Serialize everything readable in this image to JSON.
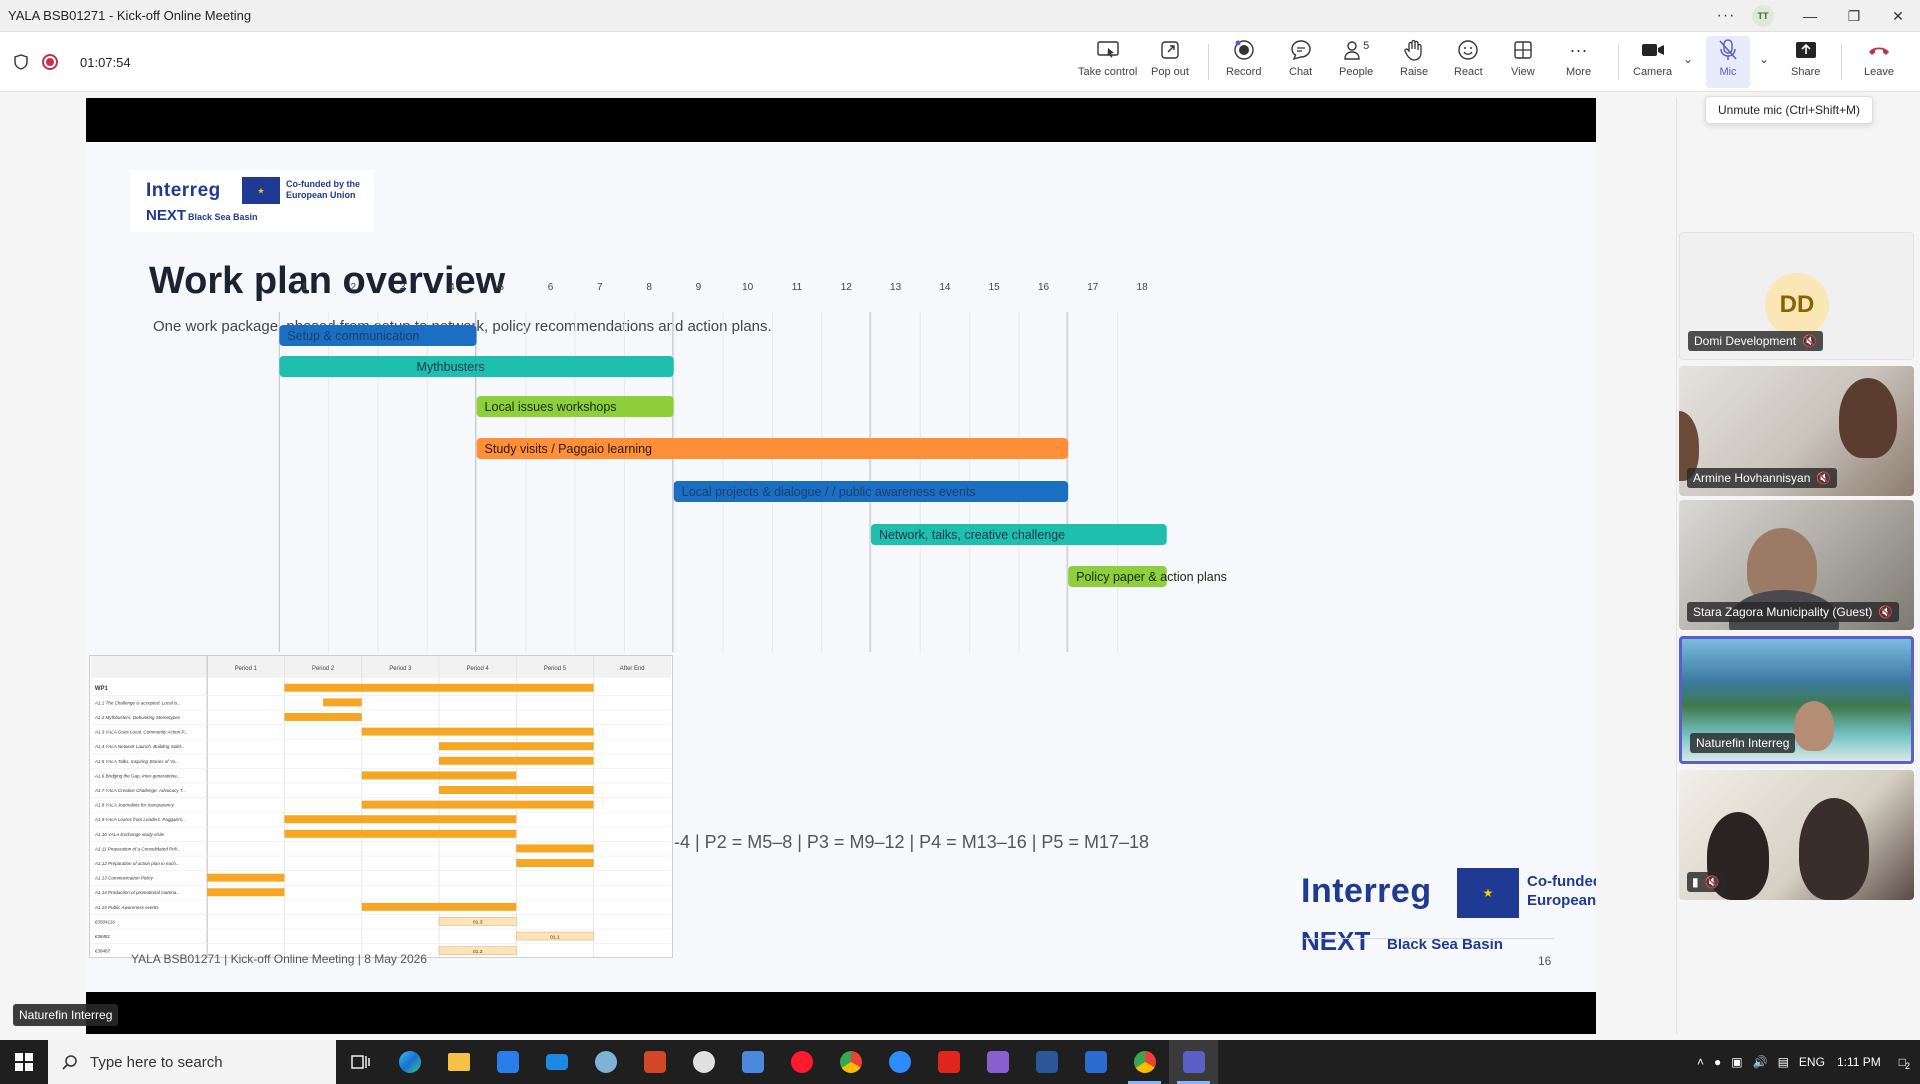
{
  "window": {
    "title": "YALA BSB01271 - Kick-off Online Meeting",
    "avatar_initials": "TT"
  },
  "toolbar": {
    "timer": "01:07:54",
    "take_control": "Take control",
    "pop_out": "Pop out",
    "record": "Record",
    "chat": "Chat",
    "people": "People",
    "people_count": "5",
    "raise": "Raise",
    "react": "React",
    "view": "View",
    "more": "More",
    "camera": "Camera",
    "mic": "Mic",
    "share": "Share",
    "leave": "Leave",
    "mic_tooltip": "Unmute mic (Ctrl+Shift+M)"
  },
  "slide": {
    "logo_brand": "Interreg",
    "logo_next": "NEXT",
    "logo_bsb": "Black Sea Basin",
    "logo_cofund": "Co-funded by the European Union",
    "title": "Work plan overview",
    "subtitle": "One work package, phased from setup to network, policy recommendations and action plans.",
    "periods_note": "-4 | P2 = M5–8 | P3 = M9–12 | P4 = M13–16 | P5 = M17–18",
    "footer": "YALA BSB01271 | Kick-off Online Meeting | 8 May 2026",
    "page_number": "16"
  },
  "chart_data": {
    "type": "gantt",
    "x_ticks": [
      1,
      2,
      3,
      4,
      5,
      6,
      7,
      8,
      9,
      10,
      11,
      12,
      13,
      14,
      15,
      16,
      17,
      18
    ],
    "xlim": [
      0.5,
      18.5
    ],
    "phase_lines": [
      4.5,
      8.5,
      12.5,
      16.5
    ],
    "tasks": [
      {
        "label": "Setup & communication",
        "start": 1,
        "end": 4,
        "color": "#1b6fc2",
        "text_color": "#1c3f6e"
      },
      {
        "label": "Mythbusters",
        "start": 1,
        "end": 8,
        "color": "#1fbfb0",
        "text_color": "#1a3a4a",
        "center": true
      },
      {
        "label": "Local issues workshops",
        "start": 5,
        "end": 8,
        "color": "#8fcf3c",
        "text_color": "#1a2a10"
      },
      {
        "label": "Study visits / Paggaio learning",
        "start": 5,
        "end": 16,
        "color": "#ff9038",
        "text_color": "#2a1a0a"
      },
      {
        "label": "Local projects & dialogue / / public awareness events",
        "start": 9,
        "end": 16,
        "color": "#1b6fc2",
        "text_color": "#1c3f6e"
      },
      {
        "label": "Network, talks, creative challenge",
        "start": 13,
        "end": 18,
        "color": "#1fbfb0",
        "text_color": "#1a3a4a"
      },
      {
        "label": "Policy paper & action plans",
        "start": 17,
        "end": 18,
        "color": "#8fcf3c",
        "text_color": "#1a2a10"
      }
    ]
  },
  "small_table": {
    "headers": [
      "",
      "Period 1",
      "Period 2",
      "Period 3",
      "Period 4",
      "Period 5",
      "After End"
    ],
    "rows": [
      {
        "label": "WP1",
        "bars": [
          [
            1,
            5
          ]
        ]
      },
      {
        "label": "A1.1 The Challenge is accepted. Local is...",
        "bars": [
          [
            1.5,
            2
          ]
        ]
      },
      {
        "label": "A1.2 Mythbusters. Debunking Stereotypes",
        "bars": [
          [
            1,
            2
          ]
        ]
      },
      {
        "label": "A1.3 YALA Goes Local. Community Action P...",
        "bars": [
          [
            2,
            5
          ]
        ]
      },
      {
        "label": "A1.4 YALA Network Launch. Building Solid...",
        "bars": [
          [
            3,
            5
          ]
        ]
      },
      {
        "label": "A1.5 YALA Talks. Inspiring Stories of Yo...",
        "bars": [
          [
            3,
            5
          ]
        ]
      },
      {
        "label": "A1.6 Bridging the Gap. Inter-generationa...",
        "bars": [
          [
            2,
            4
          ]
        ]
      },
      {
        "label": "A1.7 YALA Creative Challenge. Advocacy T...",
        "bars": [
          [
            3,
            5
          ]
        ]
      },
      {
        "label": "A1.8 YALA Journalists for transparency",
        "bars": [
          [
            2,
            5
          ]
        ]
      },
      {
        "label": "A1.9 YALA Learns from Leaders. Paggaio's...",
        "bars": [
          [
            1,
            4
          ]
        ]
      },
      {
        "label": "A1.10 YALA Exchange study visits",
        "bars": [
          [
            1,
            4
          ]
        ]
      },
      {
        "label": "A1.11 Preparation of a Consolidated Poli...",
        "bars": [
          [
            4,
            5
          ]
        ]
      },
      {
        "label": "A1.12 Preparation of action plan in each...",
        "bars": [
          [
            4,
            5
          ]
        ]
      },
      {
        "label": "A1.13 Communication Policy",
        "bars": [
          [
            0,
            1
          ]
        ]
      },
      {
        "label": "A1.14 Production of promotional materia...",
        "bars": [
          [
            0,
            1
          ]
        ]
      },
      {
        "label": "A1.15 Public Awareness events",
        "bars": [
          [
            2,
            4
          ]
        ]
      },
      {
        "label": "€3504116",
        "bars": [
          [
            3,
            4
          ]
        ],
        "tag": "01.3"
      },
      {
        "label": "€38481",
        "bars": [
          [
            4,
            5
          ]
        ],
        "tag": "01.1"
      },
      {
        "label": "€38487",
        "bars": [
          [
            3,
            4
          ]
        ],
        "tag": "01.2"
      }
    ]
  },
  "participants": [
    {
      "name": "Domi Development",
      "initials": "DD"
    },
    {
      "name": "Armine Hovhannisyan"
    },
    {
      "name": "Stara Zagora Municipality (Guest)"
    },
    {
      "name": "Naturefin Interreg"
    }
  ],
  "stage_label": "Naturefin Interreg",
  "taskbar": {
    "search_placeholder": "Type here to search",
    "language": "ENG",
    "time": "1:11 PM",
    "notification_count": "2"
  }
}
